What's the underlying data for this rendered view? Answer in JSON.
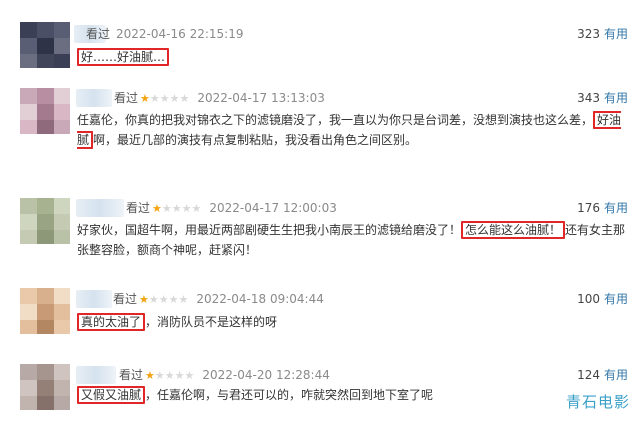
{
  "reviews": [
    {
      "watched": "看过",
      "stars_on": 0,
      "date": "2022-04-16 22:15:19",
      "votes": "323",
      "useful": "有用",
      "pre": "",
      "highlight": "好……好油腻…",
      "post": "",
      "avatar_colors": [
        "#3a3f55",
        "#4a4f66",
        "#5a5e74",
        "#2f3347",
        "#6a6e80",
        "#40455a"
      ]
    },
    {
      "watched": "看过",
      "stars_on": 1,
      "date": "2022-04-17 13:13:03",
      "votes": "343",
      "useful": "有用",
      "pre": "任嘉伦，你真的把我对锦衣之下的滤镜磨没了，我一直以为你只是台词差，没想到演技也这么差，",
      "highlight": "好油腻",
      "post": "啊，最近几部的演技有点复制粘贴，我没看出角色之间区别。",
      "avatar_colors": [
        "#c9a9b8",
        "#b88fa2",
        "#e2cfd6",
        "#a47a8e",
        "#d9b7c4",
        "#8f6a7c"
      ]
    },
    {
      "watched": "看过",
      "stars_on": 1,
      "date": "2022-04-17 12:00:03",
      "votes": "176",
      "useful": "有用",
      "pre": "好家伙，国超牛啊，用最近两部剧硬生生把我小南辰王的滤镜给磨没了！",
      "highlight": "怎么能这么油腻！",
      "post": "还有女主那张整容脸，额商个神呢，赶紧闪！",
      "avatar_colors": [
        "#b9c2a6",
        "#a7b291",
        "#cfd6bf",
        "#98a484",
        "#c4cbb2",
        "#8d9878"
      ]
    },
    {
      "watched": "看过",
      "stars_on": 1,
      "date": "2022-04-18 09:04:44",
      "votes": "100",
      "useful": "有用",
      "pre": "",
      "highlight": "真的太油了",
      "post": "，消防队员不是这样的呀",
      "avatar_colors": [
        "#e9c9a9",
        "#d8b08e",
        "#f1dcc6",
        "#c99a76",
        "#e4bf9d",
        "#b48763"
      ]
    },
    {
      "watched": "看过",
      "stars_on": 1,
      "date": "2022-04-20 12:28:44",
      "votes": "124",
      "useful": "有用",
      "pre": "",
      "highlight": "又假又油腻",
      "post": "，任嘉伦啊，与君还可以的，咋就突然回到地下室了呢",
      "avatar_colors": [
        "#b7aaa6",
        "#a6958f",
        "#cfc4c0",
        "#958078",
        "#c1b3ae",
        "#86716a"
      ]
    }
  ],
  "watermark": "青石电影"
}
